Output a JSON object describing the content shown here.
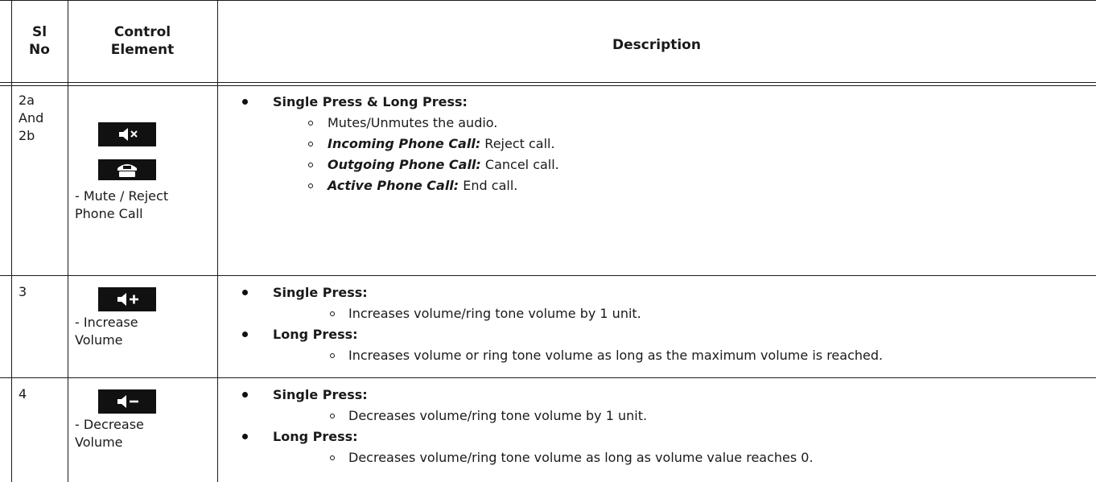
{
  "header": {
    "sl_no": "Sl No",
    "sl_line1": "Sl",
    "sl_line2": "No",
    "control_line1": "Control",
    "control_line2": "Element",
    "description": "Description"
  },
  "rows": [
    {
      "sl_line1": "2a",
      "sl_line2": "And",
      "sl_line3": "2b",
      "icons": [
        "mute-icon",
        "reject-call-icon"
      ],
      "control_label_line1": "- Mute / Reject",
      "control_label_line2": "Phone Call",
      "bullets": [
        {
          "title": "Single Press & Long Press:",
          "items": [
            {
              "bold_italic": "",
              "text": "Mutes/Unmutes the audio."
            },
            {
              "bold_italic": "Incoming Phone Call:",
              "text": " Reject call."
            },
            {
              "bold_italic": "Outgoing Phone Call:",
              "text": " Cancel call."
            },
            {
              "bold_italic": "Active Phone Call:",
              "text": " End call."
            }
          ]
        }
      ]
    },
    {
      "sl_line1": "3",
      "icons": [
        "volume-up-icon"
      ],
      "control_label_line1": "- Increase",
      "control_label_line2": "Volume",
      "bullets": [
        {
          "title": "Single Press:",
          "items": [
            {
              "text": "Increases volume/ring tone volume by 1 unit."
            }
          ]
        },
        {
          "title": "Long Press:",
          "items": [
            {
              "text": "Increases volume or ring tone volume as long as the maximum volume is reached."
            }
          ]
        }
      ]
    },
    {
      "sl_line1": "4",
      "icons": [
        "volume-down-icon"
      ],
      "control_label_line1": "- Decrease",
      "control_label_line2": "Volume",
      "bullets": [
        {
          "title": "Single Press:",
          "items": [
            {
              "text": "Decreases volume/ring tone volume by 1 unit."
            }
          ]
        },
        {
          "title": "Long Press:",
          "items": [
            {
              "text": "Decreases volume/ring tone volume as long as volume value reaches 0."
            }
          ]
        }
      ]
    }
  ]
}
